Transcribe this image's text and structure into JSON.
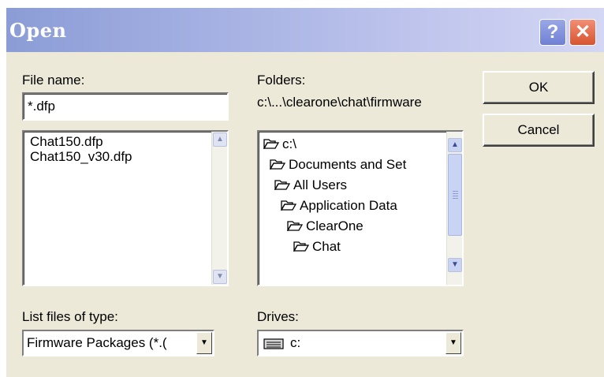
{
  "dialog": {
    "title": "Open",
    "help_glyph": "?",
    "close_glyph": "✕"
  },
  "file_name": {
    "label": "File name:",
    "value": "*.dfp"
  },
  "files": [
    "Chat150.dfp",
    "Chat150_v30.dfp"
  ],
  "folders": {
    "label": "Folders:",
    "current_path": "c:\\...\\clearone\\chat\\firmware",
    "tree": [
      "c:\\",
      "Documents and Set",
      "All Users",
      "Application Data",
      "ClearOne",
      "Chat"
    ]
  },
  "buttons": {
    "ok": "OK",
    "cancel": "Cancel"
  },
  "file_type": {
    "label": "List files of type:",
    "selected": "Firmware Packages  (*.("
  },
  "drives": {
    "label": "Drives:",
    "selected": "c:"
  },
  "icons": {
    "folder": "open-folder-icon",
    "drive": "hard-drive-icon",
    "dropdown": "chevron-down-icon"
  }
}
